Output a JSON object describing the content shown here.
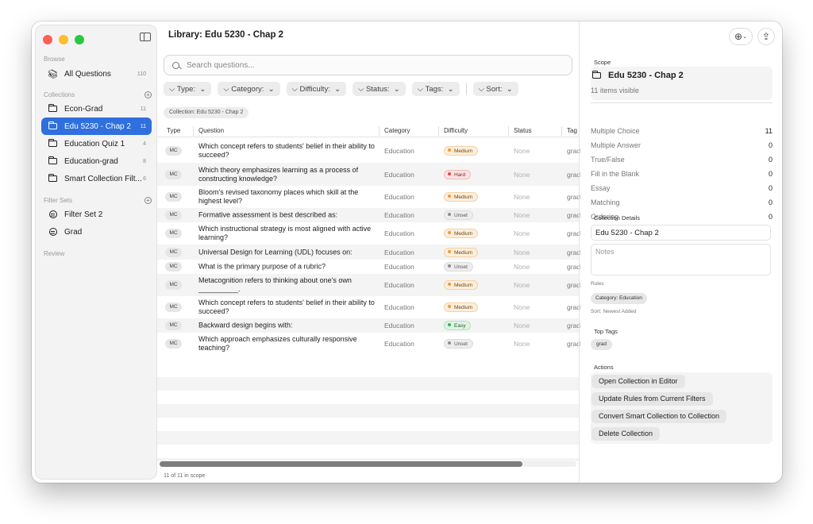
{
  "colors": {
    "accent": "#2f6fde",
    "traffic_red": "#fe5f57",
    "traffic_yellow": "#febc2e",
    "traffic_green": "#28c840",
    "difficulty_medium": "#f29a3a",
    "difficulty_hard": "#e5484d",
    "difficulty_unset": "#8e8e8e",
    "difficulty_easy": "#34b35a"
  },
  "sidebar": {
    "browse_label": "Browse",
    "all_questions": {
      "label": "All Questions",
      "count": "110",
      "icon": "library-icon"
    },
    "collections_label": "Collections",
    "collections": [
      {
        "label": "Econ-Grad",
        "count": "11",
        "icon": "folder-icon"
      },
      {
        "label": "Edu 5230 - Chap 2",
        "count": "11",
        "icon": "smart-folder-icon",
        "selected": true
      },
      {
        "label": "Education Quiz 1",
        "count": "4",
        "icon": "folder-icon"
      },
      {
        "label": "Education-grad",
        "count": "8",
        "icon": "folder-icon"
      },
      {
        "label": "Smart Collection Filt...",
        "count": "6",
        "icon": "smart-folder-icon"
      }
    ],
    "filter_sets_label": "Filter Sets",
    "filter_sets": [
      {
        "label": "Filter Set 2",
        "icon": "filter-icon"
      },
      {
        "label": "Grad",
        "icon": "filter-icon"
      }
    ],
    "review_label": "Review"
  },
  "main": {
    "title": "Library: Edu 5230 - Chap 2",
    "search_placeholder": "Search questions...",
    "filters": [
      "Type:",
      "Category:",
      "Difficulty:",
      "Status:",
      "Tags:"
    ],
    "sort": "Sort:",
    "scope_pill": "Collection: Edu 5230 - Chap 2",
    "columns": [
      "Type",
      "Question",
      "Category",
      "Difficulty",
      "Status",
      "Tag"
    ],
    "rows": [
      {
        "type": "MC",
        "question": "Which concept refers to students' belief in their ability to succeed?",
        "category": "Education",
        "difficulty": "Medium",
        "status": "None",
        "tag": "grad"
      },
      {
        "type": "MC",
        "question": "Which theory emphasizes learning as a process of constructing knowledge?",
        "category": "Education",
        "difficulty": "Hard",
        "status": "None",
        "tag": "grad"
      },
      {
        "type": "MC",
        "question": "Bloom's revised taxonomy places which skill at the highest level?",
        "category": "Education",
        "difficulty": "Medium",
        "status": "None",
        "tag": "grad"
      },
      {
        "type": "MC",
        "question": "Formative assessment is best described as:",
        "category": "Education",
        "difficulty": "Unset",
        "status": "None",
        "tag": "grad"
      },
      {
        "type": "MC",
        "question": "Which instructional strategy is most aligned with active learning?",
        "category": "Education",
        "difficulty": "Medium",
        "status": "None",
        "tag": "grad"
      },
      {
        "type": "MC",
        "question": "Universal Design for Learning (UDL) focuses on:",
        "category": "Education",
        "difficulty": "Medium",
        "status": "None",
        "tag": "grad"
      },
      {
        "type": "MC",
        "question": "What is the primary purpose of a rubric?",
        "category": "Education",
        "difficulty": "Unset",
        "status": "None",
        "tag": "grad"
      },
      {
        "type": "MC",
        "question": "Metacognition refers to thinking about one's own __________.",
        "category": "Education",
        "difficulty": "Medium",
        "status": "None",
        "tag": "grad"
      },
      {
        "type": "MC",
        "question": "Which concept refers to students' belief in their ability to succeed?",
        "category": "Education",
        "difficulty": "Medium",
        "status": "None",
        "tag": "grad"
      },
      {
        "type": "MC",
        "question": "Backward design begins with:",
        "category": "Education",
        "difficulty": "Easy",
        "status": "None",
        "tag": "grad"
      },
      {
        "type": "MC",
        "question": "Which approach emphasizes culturally responsive teaching?",
        "category": "Education",
        "difficulty": "Unset",
        "status": "None",
        "tag": "grad"
      }
    ],
    "horizontal_scroll_fraction": 0.87,
    "footer": "11 of 11 in scope"
  },
  "right": {
    "scope_label": "Scope",
    "scope_title": "Edu 5230 - Chap 2",
    "scope_sub": "11 items visible",
    "type_counts": [
      {
        "label": "Multiple Choice",
        "value": "11"
      },
      {
        "label": "Multiple Answer",
        "value": "0"
      },
      {
        "label": "True/False",
        "value": "0"
      },
      {
        "label": "Fill in the Blank",
        "value": "0"
      },
      {
        "label": "Essay",
        "value": "0"
      },
      {
        "label": "Matching",
        "value": "0"
      },
      {
        "label": "Ordering",
        "value": "0"
      }
    ],
    "details_label": "Collection Details",
    "name_value": "Edu 5230 - Chap 2",
    "notes_placeholder": "Notes",
    "rules_label": "Rules",
    "rule_pill": "Category: Education",
    "sort_note": "Sort: Newest Added",
    "top_tags_label": "Top Tags",
    "top_tag": "grad",
    "actions_label": "Actions",
    "actions": [
      "Open Collection in Editor",
      "Update Rules from Current Filters",
      "Convert Smart Collection to Collection",
      "Delete Collection"
    ]
  }
}
